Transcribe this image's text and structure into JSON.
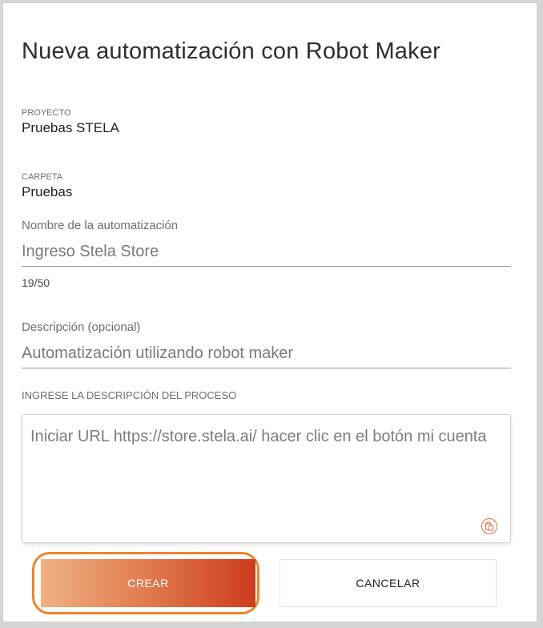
{
  "dialog": {
    "title": "Nueva automatización con Robot Maker"
  },
  "project": {
    "caption": "PROYECTO",
    "value": "Pruebas STELA"
  },
  "folder": {
    "caption": "CARPETA",
    "value": "Pruebas"
  },
  "name_field": {
    "label": "Nombre de la automatización",
    "value": "Ingreso Stela Store",
    "counter": "19/50"
  },
  "description_field": {
    "label": "Descripción (opcional)",
    "value": "Automatización utilizando robot maker"
  },
  "process": {
    "caption": "INGRESE LA DESCRIPCIÓN DEL PROCESO",
    "value": "Iniciar URL https://store.stela.ai/ hacer clic en el botón mi cuenta",
    "paste_icon": "clipboard-paste-icon"
  },
  "actions": {
    "create_label": "CREAR",
    "cancel_label": "CANCELAR",
    "create_highlight_color": "#f0832a",
    "create_gradient": [
      "#eeb283",
      "#e07a4d",
      "#cc3c1e"
    ]
  }
}
